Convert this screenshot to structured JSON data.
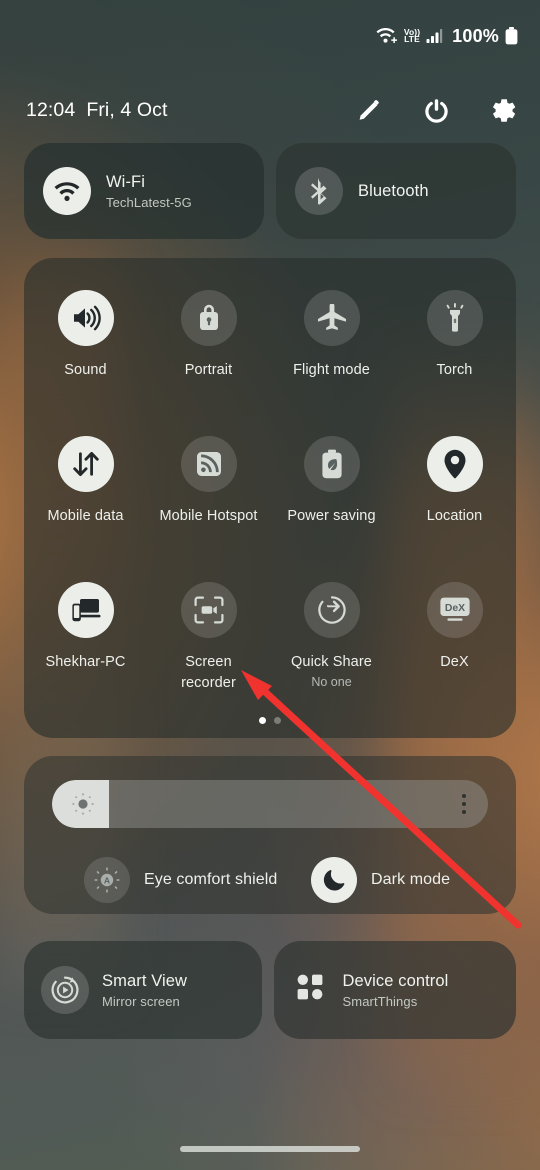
{
  "status_bar": {
    "wifi_icon": "wifi-plus-icon",
    "volte_top": "Vo))",
    "volte_bottom": "LTE",
    "signal_icon": "cellular-signal-icon",
    "battery_percent": "100%",
    "battery_icon": "battery-full-icon"
  },
  "header": {
    "time": "12:04",
    "date": "Fri, 4 Oct",
    "edit_icon": "pencil-icon",
    "power_icon": "power-icon",
    "settings_icon": "gear-icon"
  },
  "connectivity": [
    {
      "name": "wifi",
      "title": "Wi-Fi",
      "subtitle": "TechLatest-5G",
      "icon": "wifi-icon",
      "active": true
    },
    {
      "name": "bluetooth",
      "title": "Bluetooth",
      "subtitle": "",
      "icon": "bluetooth-icon",
      "active": false
    }
  ],
  "quick_settings": {
    "tiles": [
      {
        "name": "sound",
        "label": "Sound",
        "sub": "",
        "icon": "speaker-icon",
        "active": true
      },
      {
        "name": "portrait",
        "label": "Portrait",
        "sub": "",
        "icon": "rotation-lock-icon",
        "active": false
      },
      {
        "name": "flight-mode",
        "label": "Flight mode",
        "sub": "",
        "icon": "airplane-icon",
        "active": false
      },
      {
        "name": "torch",
        "label": "Torch",
        "sub": "",
        "icon": "flashlight-icon",
        "active": false
      },
      {
        "name": "mobile-data",
        "label": "Mobile data",
        "sub": "",
        "icon": "data-arrows-icon",
        "active": true
      },
      {
        "name": "mobile-hotspot",
        "label": "Mobile Hotspot",
        "sub": "",
        "icon": "hotspot-icon",
        "active": false
      },
      {
        "name": "power-saving",
        "label": "Power saving",
        "sub": "",
        "icon": "battery-leaf-icon",
        "active": false
      },
      {
        "name": "location",
        "label": "Location",
        "sub": "",
        "icon": "location-pin-icon",
        "active": true
      },
      {
        "name": "shekhar-pc",
        "label": "Shekhar-PC",
        "sub": "",
        "icon": "link-to-windows-icon",
        "active": true
      },
      {
        "name": "screen-recorder",
        "label": "Screen recorder",
        "sub": "",
        "icon": "screen-record-icon",
        "active": false
      },
      {
        "name": "quick-share",
        "label": "Quick Share",
        "sub": "No one",
        "icon": "quick-share-icon",
        "active": false
      },
      {
        "name": "dex",
        "label": "DeX",
        "sub": "",
        "icon": "dex-icon",
        "active": false
      }
    ],
    "page_dots": {
      "count": 2,
      "active_index": 0
    }
  },
  "brightness": {
    "slider_name": "brightness-slider",
    "fill_percent": 13,
    "brightness_icon": "brightness-icon",
    "more_icon": "more-options-icon",
    "modes": [
      {
        "name": "eye-comfort-shield",
        "label": "Eye comfort shield",
        "icon": "eye-comfort-icon",
        "active": false
      },
      {
        "name": "dark-mode",
        "label": "Dark mode",
        "icon": "moon-icon",
        "active": true
      }
    ]
  },
  "bottom_tiles": [
    {
      "name": "smart-view",
      "title": "Smart View",
      "subtitle": "Mirror screen",
      "icon": "smart-view-icon",
      "active": false
    },
    {
      "name": "device-control",
      "title": "Device control",
      "subtitle": "SmartThings",
      "icon": "smartthings-grid-icon",
      "active": false
    }
  ],
  "annotation": {
    "name": "red-arrow-annotation",
    "color": "#f0332e",
    "points_to": "screen-recorder"
  },
  "home_indicator": "home-indicator"
}
